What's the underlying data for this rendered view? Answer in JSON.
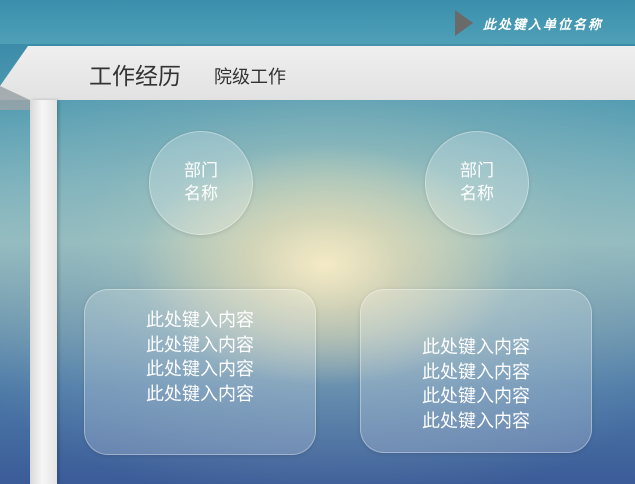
{
  "header": {
    "unit_name": "此处键入单位名称"
  },
  "title": {
    "main": "工作经历",
    "sub": "院级工作"
  },
  "departments": [
    {
      "line1": "部门",
      "line2": "名称"
    },
    {
      "line1": "部门",
      "line2": "名称"
    }
  ],
  "content_boxes": [
    {
      "lines": [
        "此处键入内容",
        "此处键入内容",
        "此处键入内容",
        "此处键入内容"
      ]
    },
    {
      "lines": [
        "此处键入内容",
        "此处键入内容",
        "此处键入内容",
        "此处键入内容"
      ]
    }
  ],
  "colors": {
    "title_bar": "#e8e8e8",
    "title_text": "#333333",
    "tag_triangle": "#6a6a6a",
    "body_text": "#ffffff"
  },
  "icons": {
    "unit_tag": "triangle-right-icon"
  }
}
